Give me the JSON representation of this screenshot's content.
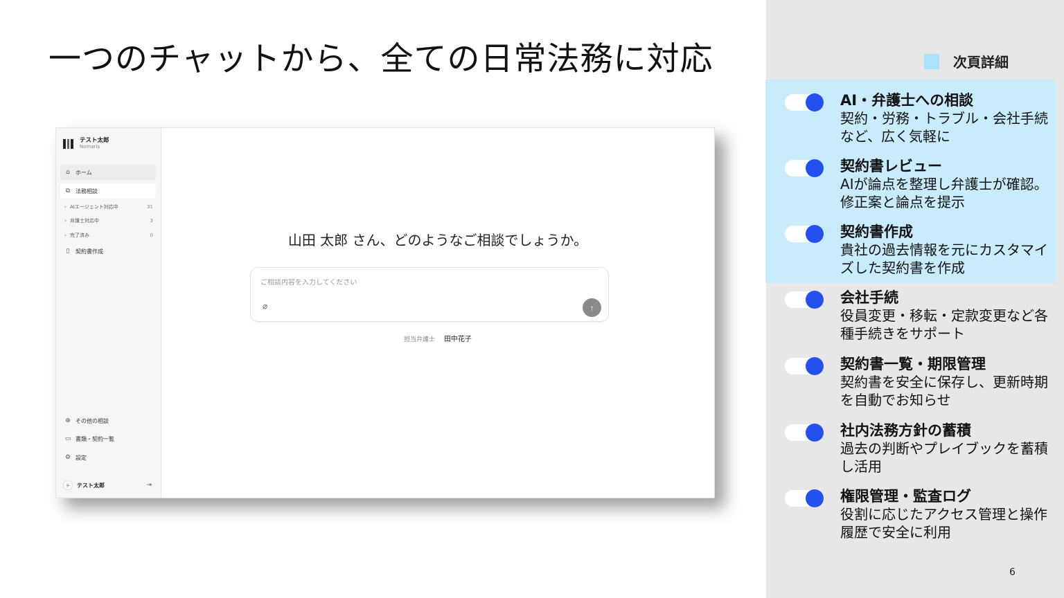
{
  "slide": {
    "title": "一つのチャットから、全ての日常法務に対応",
    "page_number": "6"
  },
  "legend": {
    "label": "次頁詳細",
    "color": "#a9e3fb"
  },
  "app": {
    "brand": {
      "name": "テスト太郎",
      "sub": "Nomaris"
    },
    "nav": {
      "home": "ホーム",
      "legal_consult": "法務相談",
      "sub_items": [
        {
          "label": "AIエージェント対応中",
          "count": "31"
        },
        {
          "label": "弁護士対応中",
          "count": "3"
        },
        {
          "label": "完了済み",
          "count": "0"
        }
      ],
      "contract_create": "契約書作成",
      "other_consult": "その他の相談",
      "documents": "書類・契約一覧",
      "settings": "設定"
    },
    "user": {
      "avatar": "テ",
      "name": "テスト太郎"
    },
    "greeting": "山田 太郎 さん、どのようなご相談でしょうか。",
    "chat": {
      "placeholder": "ご相談内容を入力してください"
    },
    "lawyer": {
      "label": "担当弁護士",
      "name": "田中花子"
    }
  },
  "features": [
    {
      "title": "AI・弁護士への相談",
      "desc": "契約・労務・トラブル・会社手続など、広く気軽に",
      "highlighted": true
    },
    {
      "title": "契約書レビュー",
      "desc": "AIが論点を整理し弁護士が確認。修正案と論点を提示",
      "highlighted": true
    },
    {
      "title": "契約書作成",
      "desc": "貴社の過去情報を元にカスタマイズした契約書を作成",
      "highlighted": true
    },
    {
      "title": "会社手続",
      "desc": "役員変更・移転・定款変更など各種手続きをサポート",
      "highlighted": false
    },
    {
      "title": "契約書一覧・期限管理",
      "desc": "契約書を安全に保存し、更新時期を自動でお知らせ",
      "highlighted": false
    },
    {
      "title": "社内法務方針の蓄積",
      "desc": "過去の判断やプレイブックを蓄積し活用",
      "highlighted": false
    },
    {
      "title": "権限管理・監査ログ",
      "desc": "役割に応じたアクセス管理と操作履歴で安全に利用",
      "highlighted": false
    }
  ],
  "colors": {
    "toggle_knob": "#2251f0",
    "highlight": "#c8ecfb",
    "panel": "#e7e7e7"
  }
}
